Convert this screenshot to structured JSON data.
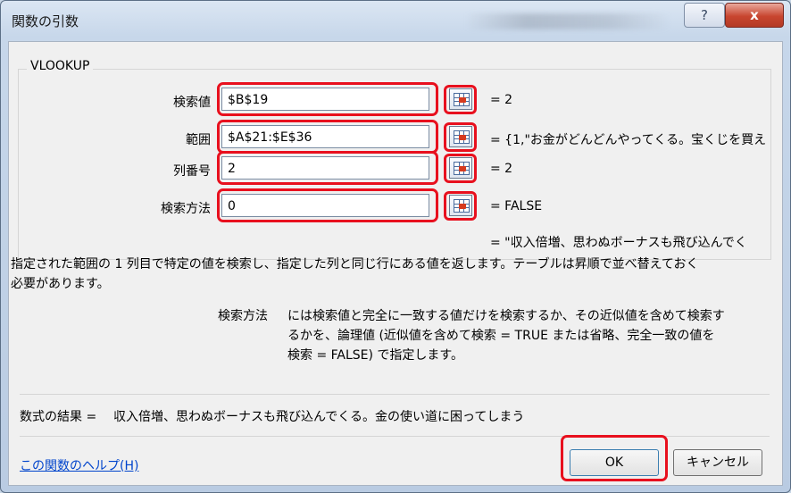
{
  "window": {
    "title": "関数の引数",
    "help_glyph": "?",
    "close_glyph": "x"
  },
  "function": {
    "name": "VLOOKUP",
    "args": [
      {
        "label": "検索値",
        "value": "$B$19",
        "result": "=  2"
      },
      {
        "label": "範囲",
        "value": "$A$21:$E$36",
        "result": "=  {1,\"お金がどんどんやってくる。宝くじを買え"
      },
      {
        "label": "列番号",
        "value": "2",
        "result": "=  2"
      },
      {
        "label": "検索方法",
        "value": "0",
        "result": "=  FALSE"
      }
    ],
    "overall_result": "=  \"収入倍増、思わぬボーナスも飛び込んでく",
    "description_line1": "指定された範囲の 1 列目で特定の値を検索し、指定した列と同じ行にある値を返します。テーブルは昇順で並べ替えておく",
    "description_line2": "必要があります。",
    "arg_help_name": "検索方法",
    "arg_help_line1": "には検索値と完全に一致する値だけを検索するか、その近似値を含めて検索す",
    "arg_help_line2": "るかを、論理値 (近似値を含めて検索 = TRUE または省略、完全一致の値を",
    "arg_help_line3": "検索 = FALSE) で指定します。"
  },
  "formula_result": {
    "label": "数式の結果 =",
    "value": "収入倍増、思わぬボーナスも飛び込んでくる。金の使い道に困ってしまう"
  },
  "footer": {
    "help_link": "この関数のヘルプ(H)",
    "ok_label": "OK",
    "cancel_label": "キャンセル"
  },
  "colors": {
    "highlight": "#e8101e",
    "link": "#0044cc"
  },
  "icons": {
    "ref_button": "range-selector-icon"
  }
}
